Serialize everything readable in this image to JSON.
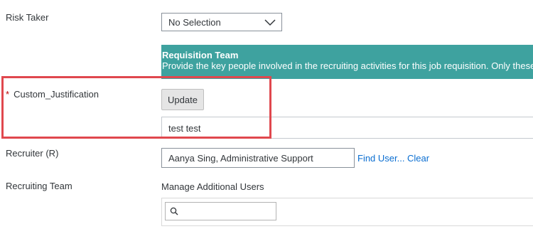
{
  "fields": {
    "risk_taker": {
      "label": "Risk Taker",
      "selected": "No Selection"
    },
    "requisition_team": {
      "title": "Requisition Team",
      "description": "Provide the key people involved in the recruiting activities for this job requisition. Only these us"
    },
    "custom_justification": {
      "required_marker": "*",
      "label": "Custom_Justification",
      "button": "Update",
      "value": "test test"
    },
    "recruiter": {
      "label": "Recruiter (R)",
      "value": "Aanya Sing, Administrative Support",
      "find_user_link": "Find User...",
      "clear_link": "Clear"
    },
    "recruiting_team": {
      "label": "Recruiting Team",
      "manage_text": "Manage Additional Users",
      "search_placeholder": ""
    }
  },
  "colors": {
    "banner": "#3ea29f",
    "highlight": "#e0484e",
    "link": "#0a6ed1",
    "required": "#bb0000"
  },
  "icons": {
    "dropdown": "chevron-down-icon",
    "search": "search-icon"
  }
}
